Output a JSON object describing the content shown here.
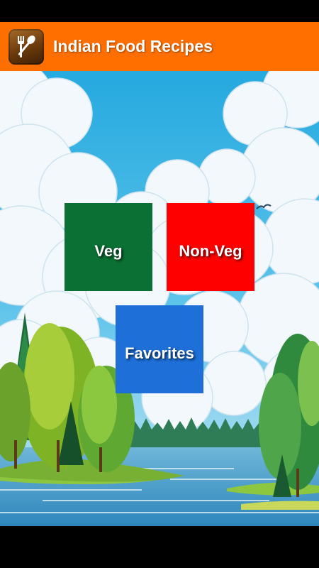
{
  "app_bar": {
    "title": "Indian Food Recipes",
    "icon": "fork-spoon-icon",
    "color": "#FF6F00"
  },
  "tiles": [
    {
      "label": "Veg",
      "color": "#0B7033"
    },
    {
      "label": "Non-Veg",
      "color": "#FF0000"
    },
    {
      "label": "Favorites",
      "color": "#1E6FD8"
    }
  ],
  "background": {
    "scene": "sky-clouds-forest-lake"
  }
}
